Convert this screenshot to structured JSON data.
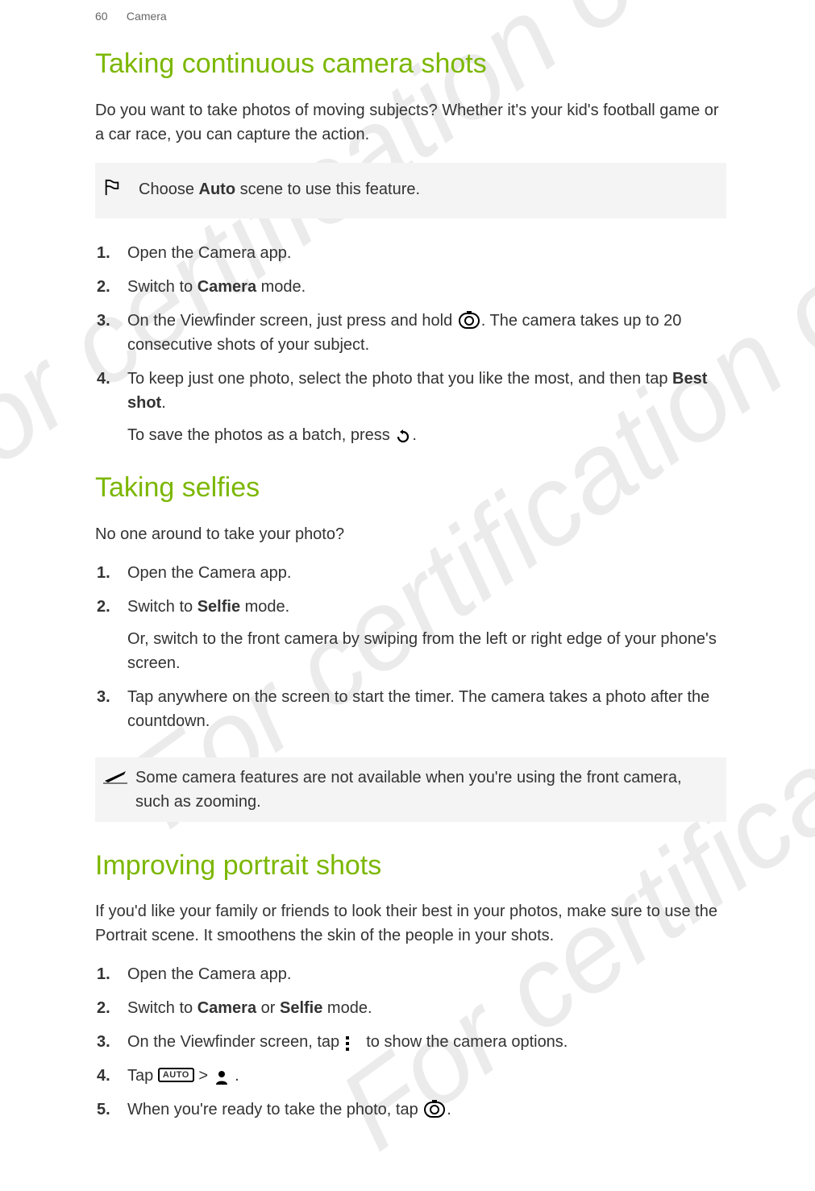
{
  "header": {
    "page_number": "60",
    "section": "Camera"
  },
  "watermark": {
    "text": "For certification only"
  },
  "section1": {
    "title": "Taking continuous camera shots",
    "intro": "Do you want to take photos of moving subjects? Whether it's your kid's football game or a car race, you can capture the action.",
    "note_prefix": "Choose ",
    "note_bold": "Auto",
    "note_suffix": " scene to use this feature.",
    "steps": {
      "s1": "Open the Camera app.",
      "s2_prefix": "Switch to ",
      "s2_bold": "Camera",
      "s2_suffix": " mode.",
      "s3_prefix": "On the Viewfinder screen, just press and hold ",
      "s3_suffix": ". The camera takes up to 20 consecutive shots of your subject.",
      "s4a_prefix": "To keep just one photo, select the photo that you like the most, and then tap ",
      "s4a_bold": "Best shot",
      "s4a_suffix": ".",
      "s4b_prefix": "To save the photos as a batch, press ",
      "s4b_suffix": "."
    }
  },
  "section2": {
    "title": "Taking selfies",
    "intro": "No one around to take your photo?",
    "steps": {
      "s1": "Open the Camera app.",
      "s2a_prefix": "Switch to ",
      "s2a_bold": "Selfie",
      "s2a_suffix": " mode.",
      "s2b": "Or, switch to the front camera by swiping from the left or right edge of your phone's screen.",
      "s3": "Tap anywhere on the screen to start the timer. The camera takes a photo after the countdown."
    },
    "note": "Some camera features are not available when you're using the front camera, such as zooming."
  },
  "section3": {
    "title": "Improving portrait shots",
    "intro": "If you'd like your family or friends to look their best in your photos, make sure to use the Portrait scene. It smoothens the skin of the people in your shots.",
    "steps": {
      "s1": "Open the Camera app.",
      "s2_prefix": "Switch to ",
      "s2_bold1": "Camera",
      "s2_mid": " or ",
      "s2_bold2": "Selfie",
      "s2_suffix": " mode.",
      "s3_prefix": "On the Viewfinder screen, tap ",
      "s3_suffix": " to show the camera options.",
      "s4_prefix": "Tap ",
      "s4_auto": "AUTO",
      "s4_gt": " > ",
      "s4_suffix": " .",
      "s5_prefix": "When you're ready to take the photo, tap ",
      "s5_suffix": "."
    }
  }
}
